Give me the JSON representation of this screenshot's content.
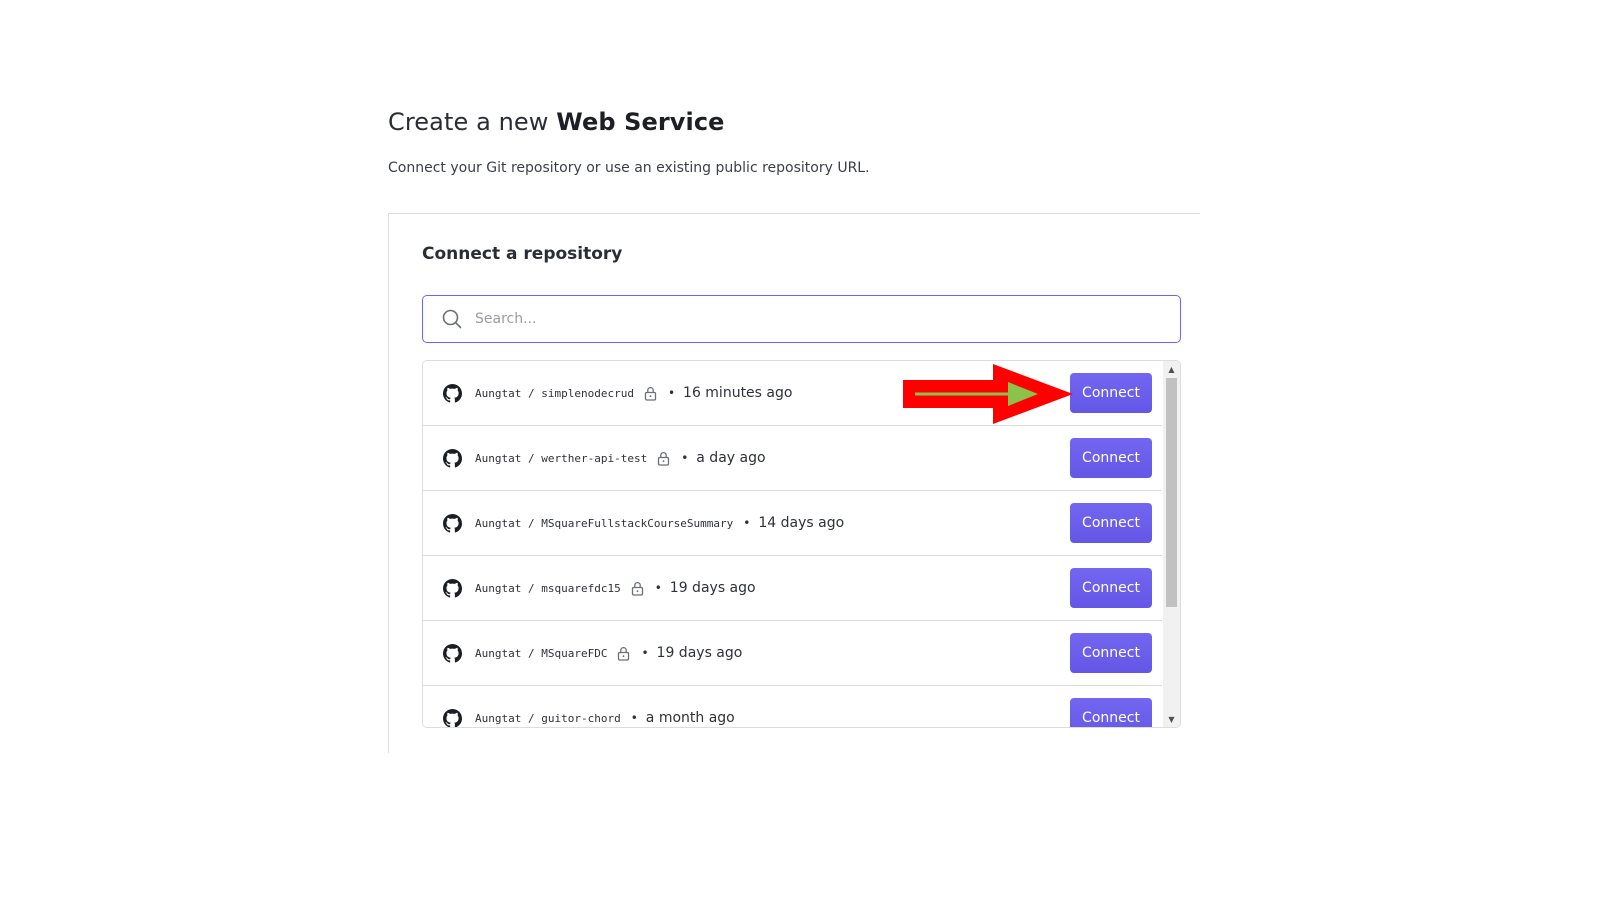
{
  "header": {
    "title_prefix": "Create a new ",
    "title_bold": "Web Service",
    "subtitle": "Connect your Git repository or use an existing public repository URL."
  },
  "card": {
    "title": "Connect a repository",
    "search": {
      "placeholder": "Search...",
      "icon": "search-icon"
    },
    "repos": [
      {
        "owner": "Aungtat",
        "name": "simplenodecrud",
        "private": true,
        "time": "16 minutes ago",
        "button": "Connect"
      },
      {
        "owner": "Aungtat",
        "name": "werther-api-test",
        "private": true,
        "time": "a day ago",
        "button": "Connect"
      },
      {
        "owner": "Aungtat",
        "name": "MSquareFullstackCourseSummary",
        "private": false,
        "time": "14 days ago",
        "button": "Connect"
      },
      {
        "owner": "Aungtat",
        "name": "msquarefdc15",
        "private": true,
        "time": "19 days ago",
        "button": "Connect"
      },
      {
        "owner": "Aungtat",
        "name": "MSquareFDC",
        "private": true,
        "time": "19 days ago",
        "button": "Connect"
      },
      {
        "owner": "Aungtat",
        "name": "guitor-chord",
        "private": false,
        "time": "a month ago",
        "button": "Connect"
      }
    ],
    "separator": " / ",
    "bullet": "•"
  },
  "colors": {
    "accent": "#6c63ff",
    "button": "#6c5ce7",
    "annotation_arrow": "#ff0000",
    "annotation_arrow_inner": "#8bc34a"
  }
}
